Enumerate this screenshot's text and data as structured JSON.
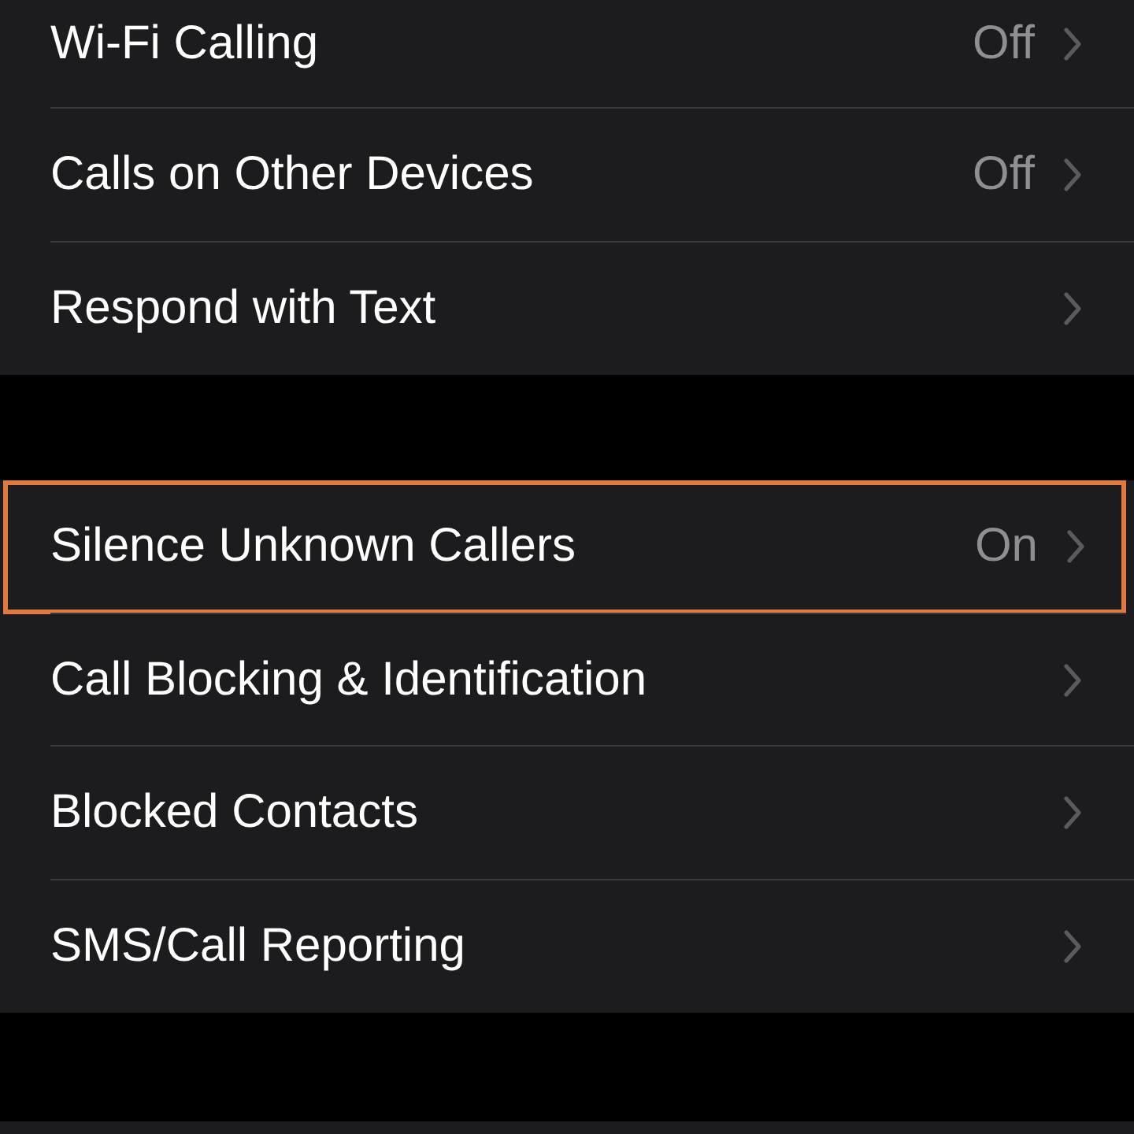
{
  "groups": [
    {
      "items": [
        {
          "label": "Wi-Fi Calling",
          "value": "Off",
          "highlighted": false
        },
        {
          "label": "Calls on Other Devices",
          "value": "Off",
          "highlighted": false
        },
        {
          "label": "Respond with Text",
          "highlighted": false
        }
      ]
    },
    {
      "items": [
        {
          "label": "Silence Unknown Callers",
          "value": "On",
          "highlighted": true
        },
        {
          "label": "Call Blocking & Identification",
          "highlighted": false
        },
        {
          "label": "Blocked Contacts",
          "highlighted": false
        },
        {
          "label": "SMS/Call Reporting",
          "highlighted": false
        }
      ]
    }
  ]
}
